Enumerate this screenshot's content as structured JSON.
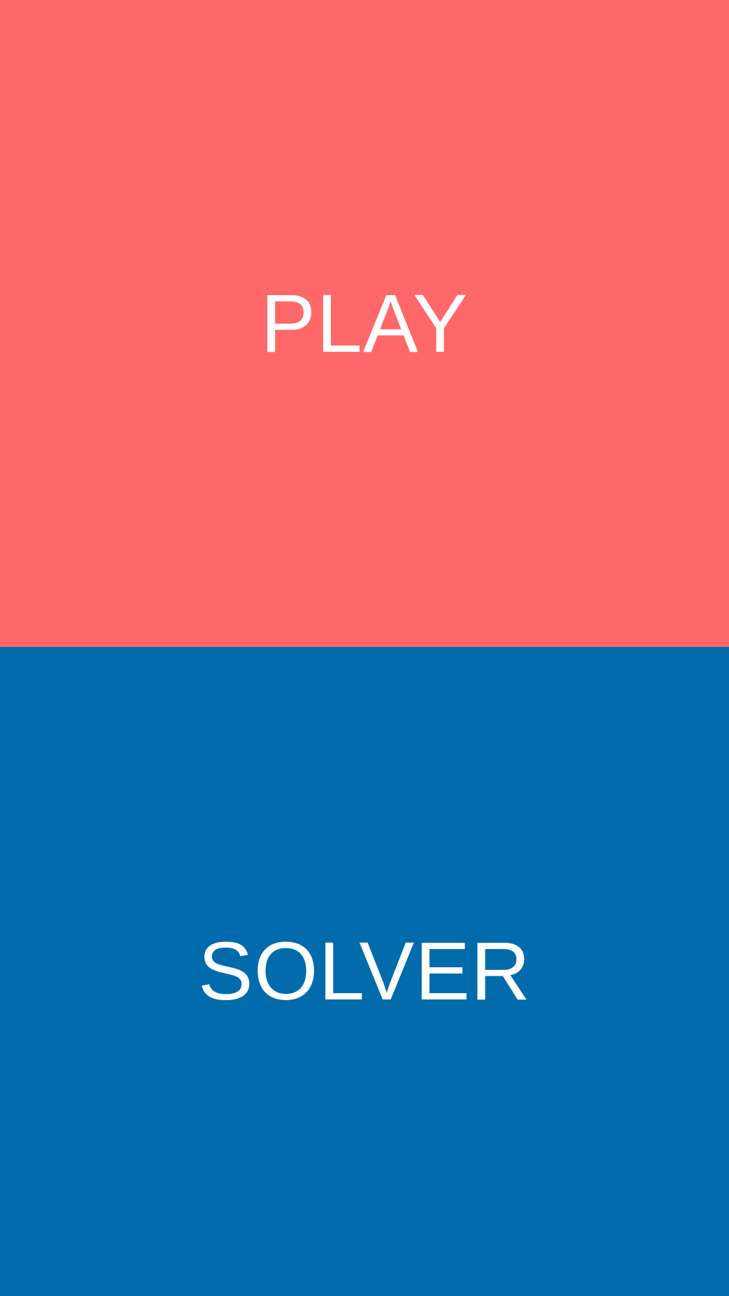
{
  "buttons": {
    "play": {
      "label": "PLAY",
      "background_color": "#FF6868",
      "text_color": "#FFFFFF"
    },
    "solver": {
      "label": "SOLVER",
      "background_color": "#016BAB",
      "text_color": "#FFFFFF"
    }
  }
}
